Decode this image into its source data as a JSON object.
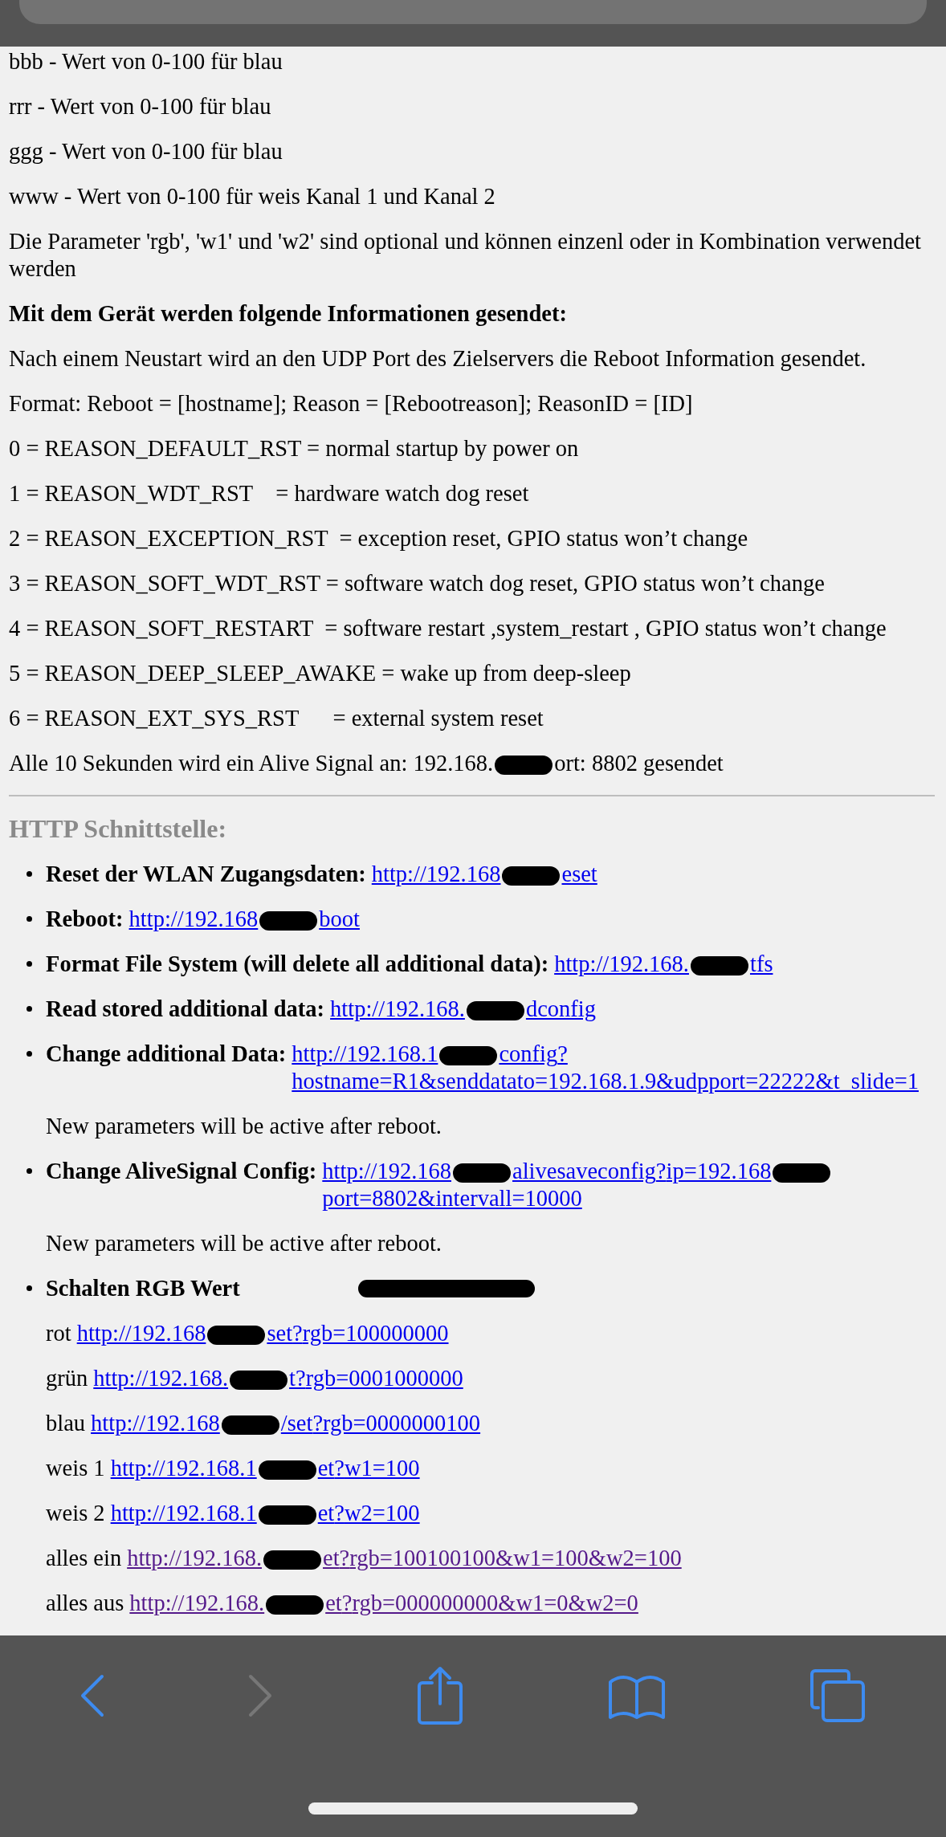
{
  "intro": [
    {
      "text": "bbb - Wert von 0-100 für blau"
    },
    {
      "text": "rrr - Wert von 0-100 für blau"
    },
    {
      "text": "ggg - Wert von 0-100 für blau"
    },
    {
      "text": "www - Wert von 0-100 für weis Kanal 1 und Kanal 2"
    },
    {
      "text": "Die Parameter 'rgb', 'w1' und 'w2' sind optional und können einzenl oder in Kombination verwendet werden"
    }
  ],
  "info_heading": "Mit dem Gerät werden folgende Informationen gesendet:",
  "info_lines": [
    "Nach einem Neustart wird an den UDP Port des Zielservers die Reboot Information gesendet.",
    "Format: Reboot = [hostname]; Reason = [Rebootreason]; ReasonID = [ID]",
    "0 = REASON_DEFAULT_RST = normal startup by power on",
    "1 = REASON_WDT_RST    = hardware watch dog reset",
    "2 = REASON_EXCEPTION_RST  = exception reset, GPIO status won’t change",
    "3 = REASON_SOFT_WDT_RST = software watch dog reset, GPIO status won’t change",
    "4 = REASON_SOFT_RESTART  = software restart ,system_restart , GPIO status won’t change",
    "5 = REASON_DEEP_SLEEP_AWAKE = wake up from deep-sleep",
    "6 = REASON_EXT_SYS_RST      = external system reset"
  ],
  "alive_line": {
    "segments": [
      "Alle 10 Sekunden wird ein Alive Signal an: 192.168.",
      "ort: 8802 gesendet"
    ]
  },
  "http_heading": "HTTP Schnittstelle:",
  "http_items": [
    {
      "label": "Reset der WLAN Zugangsdaten:",
      "link": {
        "segments": [
          "http://192.168",
          "eset"
        ],
        "visited": false
      }
    },
    {
      "label": "Reboot:",
      "link": {
        "segments": [
          "http://192.168",
          "boot"
        ],
        "visited": false
      }
    },
    {
      "label": "Format File System (will delete all additional data):",
      "link": {
        "segments": [
          "http://192.168.",
          "tfs"
        ],
        "visited": false
      }
    },
    {
      "label": "Read stored additional data:",
      "link": {
        "segments": [
          "http://192.168.",
          "dconfig"
        ],
        "visited": false
      }
    },
    {
      "label": "Change additional Data:",
      "link": {
        "segments": [
          "http://192.168.1",
          "config?hostname=R1&senddatato=192.168.1.9&udpport=22222&t_slide=1"
        ],
        "visited": false
      },
      "note": "New parameters will be active after reboot."
    },
    {
      "label": "Change AliveSignal Config:",
      "link": {
        "segments": [
          "http://192.168",
          "alivesaveconfig?ip=192.168",
          "port=8802&intervall=10000"
        ],
        "visited": false
      },
      "note": "New parameters will be active after reboot."
    },
    {
      "label": "Schalten RGB Wert",
      "scribble": true,
      "sub_links": [
        {
          "label": "rot",
          "link": {
            "segments": [
              "http://192.168",
              "set?rgb=100000000"
            ],
            "visited": false
          }
        },
        {
          "label": "grün",
          "link": {
            "segments": [
              "http://192.168.",
              "t?rgb=0001000000"
            ],
            "visited": false
          }
        },
        {
          "label": "blau",
          "link": {
            "segments": [
              "http://192.168",
              "/set?rgb=0000000100"
            ],
            "visited": false
          }
        },
        {
          "label": "weis 1",
          "link": {
            "segments": [
              "http://192.168.1",
              "et?w1=100"
            ],
            "visited": false
          }
        },
        {
          "label": "weis 2",
          "link": {
            "segments": [
              "http://192.168.1",
              "et?w2=100"
            ],
            "visited": false
          }
        },
        {
          "label": "alles ein",
          "link": {
            "segments": [
              "http://192.168.",
              "et?rgb=100100100&w1=100&w2=100"
            ],
            "visited": true
          }
        },
        {
          "label": "alles aus",
          "link": {
            "segments": [
              "http://192.168.",
              "et?rgb=000000000&w1=0&w2=0"
            ],
            "visited": true
          }
        }
      ]
    }
  ],
  "toolbar": [
    {
      "kind": "back",
      "disabled": false
    },
    {
      "kind": "forward",
      "disabled": true
    },
    {
      "kind": "share",
      "disabled": false
    },
    {
      "kind": "bookmarks",
      "disabled": false
    },
    {
      "kind": "tabs",
      "disabled": false
    }
  ]
}
